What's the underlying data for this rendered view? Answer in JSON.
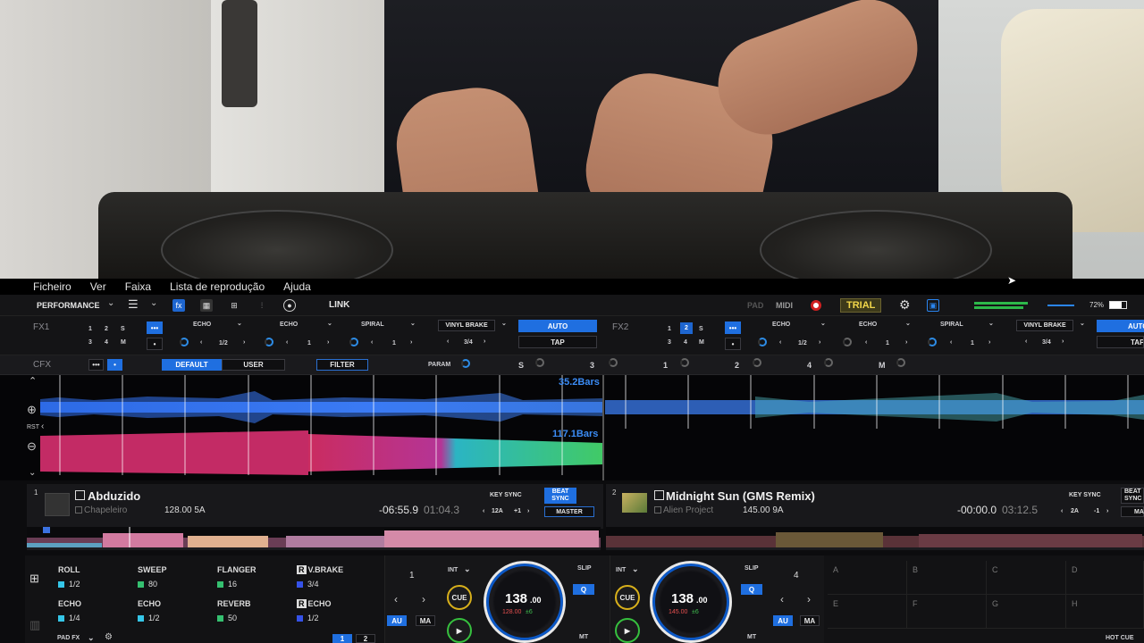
{
  "menu": {
    "items": [
      "Ficheiro",
      "Ver",
      "Faixa",
      "Lista de reprodução",
      "Ajuda"
    ]
  },
  "toolbar": {
    "layout_label": "PERFORMANCE",
    "link_label": "LINK",
    "pad_label": "PAD",
    "midi_label": "MIDI",
    "trial_label": "TRIAL",
    "battery_label": "72%"
  },
  "fx1": {
    "label": "FX1",
    "beats": [
      "1",
      "2",
      "S",
      "3",
      "4",
      "M"
    ],
    "slots": [
      "ECHO",
      "ECHO",
      "SPIRAL"
    ],
    "slot_vals": [
      "1/2",
      "1",
      "1"
    ],
    "brake_label": "VINYL BRAKE",
    "brake_val": "3/4",
    "auto_label": "AUTO",
    "tap_label": "TAP"
  },
  "fx2": {
    "label": "FX2",
    "beats": [
      "1",
      "2",
      "S",
      "3",
      "4",
      "M"
    ],
    "slots": [
      "ECHO",
      "ECHO",
      "SPIRAL"
    ],
    "slot_vals": [
      "1/2",
      "1",
      "1"
    ],
    "brake_label": "VINYL BRAKE",
    "brake_val": "3/4",
    "auto_label": "AUTO",
    "tap_label": "TAP"
  },
  "cfx": {
    "label": "CFX",
    "default_label": "DEFAULT",
    "user_label": "USER",
    "filter_label": "FILTER",
    "param_label": "PARAM",
    "knob_labels": [
      "S",
      "3",
      "1",
      "2",
      "4",
      "M"
    ]
  },
  "waveform": {
    "rst_label": "RST",
    "deck1_bars": "35.2Bars",
    "deck2_bars": "117.1Bars"
  },
  "deck1": {
    "number": "1",
    "title": "Abduzido",
    "artist": "Chapeleiro",
    "bpm_key": "128.00 5A",
    "remaining": "-06:55.9",
    "elapsed": "01:04.3",
    "key_sync_label": "KEY SYNC",
    "key_label": "12A",
    "key_shift": "+1",
    "beat_sync_label": "BEAT SYNC",
    "master_label": "MASTER"
  },
  "deck2": {
    "number": "2",
    "title": "Midnight Sun (GMS Remix)",
    "artist": "Alien Project",
    "bpm_key": "145.00 9A",
    "remaining": "-00:00.0",
    "elapsed": "03:12.5",
    "key_sync_label": "KEY SYNC",
    "key_label": "2A",
    "key_shift": "-1",
    "beat_sync_label": "BEAT SYNC",
    "master_label": "MA"
  },
  "pad_fx": {
    "label": "PAD FX",
    "pages": [
      "1",
      "2"
    ],
    "cells": [
      {
        "name": "ROLL",
        "val": "1/2",
        "color": "#35c6e8",
        "prefix": ""
      },
      {
        "name": "SWEEP",
        "val": "80",
        "color": "#35c070",
        "prefix": ""
      },
      {
        "name": "FLANGER",
        "val": "16",
        "color": "#35c070",
        "prefix": ""
      },
      {
        "name": "V.BRAKE",
        "val": "3/4",
        "color": "#3552e8",
        "prefix": "R"
      },
      {
        "name": "ECHO",
        "val": "1/4",
        "color": "#35c6e8",
        "prefix": ""
      },
      {
        "name": "ECHO",
        "val": "1/2",
        "color": "#35c6e8",
        "prefix": ""
      },
      {
        "name": "REVERB",
        "val": "50",
        "color": "#35c070",
        "prefix": ""
      },
      {
        "name": "ECHO",
        "val": "1/2",
        "color": "#3552e8",
        "prefix": "R"
      }
    ]
  },
  "deck1_ctrl": {
    "loop_val": "1",
    "int_label": "INT",
    "cue_label": "CUE",
    "au_label": "AU",
    "ma_label": "MA",
    "bpm": "138",
    "bpm_dec": ".00",
    "orig_bpm": "128.00",
    "pitch": "±6",
    "slip_label": "SLIP",
    "q_label": "Q",
    "mt_label": "MT"
  },
  "deck2_ctrl": {
    "loop_val": "4",
    "int_label": "INT",
    "cue_label": "CUE",
    "au_label": "AU",
    "ma_label": "MA",
    "bpm": "138",
    "bpm_dec": ".00",
    "orig_bpm": "145.00",
    "pitch": "±6",
    "slip_label": "SLIP",
    "q_label": "Q",
    "mt_label": "MT"
  },
  "hot_cue": {
    "letters": [
      "A",
      "B",
      "C",
      "D",
      "E",
      "F",
      "G",
      "H"
    ],
    "label": "HOT CUE"
  },
  "colors": {
    "accent": "#1f6fe0",
    "trial": "#f1d64a",
    "deck_ring": "#0b58c7"
  }
}
